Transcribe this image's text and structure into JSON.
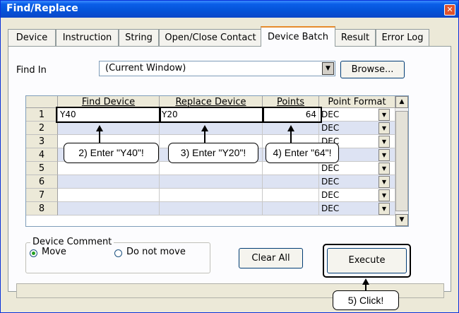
{
  "window": {
    "title": "Find/Replace",
    "close_glyph": "✕"
  },
  "tabs": [
    {
      "label": "Device"
    },
    {
      "label": "Instruction"
    },
    {
      "label": "String"
    },
    {
      "label": "Open/Close Contact"
    },
    {
      "label": "Device Batch",
      "active": true
    },
    {
      "label": "Result"
    },
    {
      "label": "Error Log"
    }
  ],
  "find_in": {
    "label": "Find In",
    "value": "(Current Window)",
    "browse_label": "Browse..."
  },
  "grid": {
    "headers": [
      "Find Device",
      "Replace Device",
      "Points",
      "Point Format"
    ],
    "rows": [
      {
        "num": "1",
        "find": "Y40",
        "replace": "Y20",
        "points": "64",
        "format": "DEC"
      },
      {
        "num": "2",
        "find": "",
        "replace": "",
        "points": "",
        "format": "DEC"
      },
      {
        "num": "3",
        "find": "",
        "replace": "",
        "points": "",
        "format": "DEC"
      },
      {
        "num": "4",
        "find": "",
        "replace": "",
        "points": "",
        "format": "DEC"
      },
      {
        "num": "5",
        "find": "",
        "replace": "",
        "points": "",
        "format": "DEC"
      },
      {
        "num": "6",
        "find": "",
        "replace": "",
        "points": "",
        "format": "DEC"
      },
      {
        "num": "7",
        "find": "",
        "replace": "",
        "points": "",
        "format": "DEC"
      },
      {
        "num": "8",
        "find": "",
        "replace": "",
        "points": "",
        "format": "DEC"
      }
    ]
  },
  "device_comment": {
    "legend": "Device Comment",
    "move_label": "Move",
    "do_not_move_label": "Do not move",
    "selected": "Move"
  },
  "buttons": {
    "clear_all": "Clear All",
    "execute": "Execute"
  },
  "callouts": {
    "step2": "2) Enter \"Y40\"!",
    "step3": "3) Enter \"Y20\"!",
    "step4": "4) Enter \"64\"!",
    "step5": "5) Click!"
  },
  "colors": {
    "titlebar": "#0453d8",
    "alt_row": "#dde3f3",
    "active_tab_accent": "#e68b2c"
  }
}
